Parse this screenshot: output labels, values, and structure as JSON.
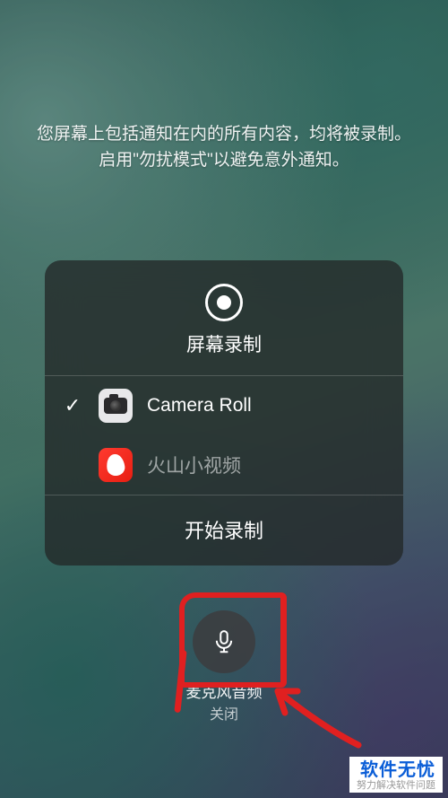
{
  "instruction": {
    "line1": "您屏幕上包括通知在内的所有内容，均将被录制。",
    "line2": "启用\"勿扰模式\"以避免意外通知。"
  },
  "panel": {
    "title": "屏幕录制",
    "options": [
      {
        "label": "Camera Roll",
        "selected": true,
        "icon": "camera-icon"
      },
      {
        "label": "火山小视频",
        "selected": false,
        "icon": "huoshan-icon"
      }
    ],
    "start_label": "开始录制"
  },
  "mic": {
    "label": "麦克风音频",
    "state": "关闭"
  },
  "watermark": {
    "main": "软件无忧",
    "sub": "努力解决软件问题"
  },
  "colors": {
    "annotation": "#e02020",
    "panel_bg": "rgba(35,40,40,0.78)"
  }
}
